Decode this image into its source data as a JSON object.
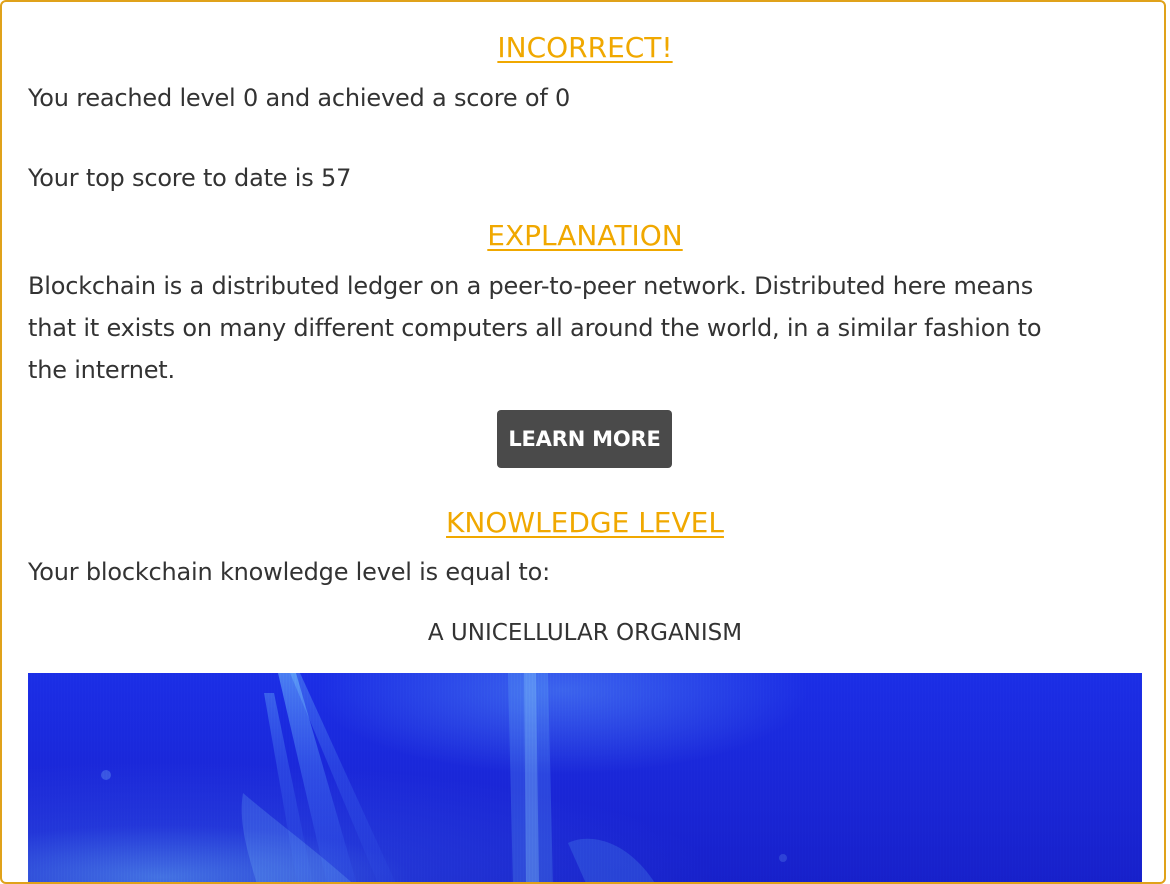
{
  "result": {
    "title": "INCORRECT!",
    "summary_line": "You reached level 0 and achieved a score of 0",
    "top_score_line": "Your top score to date is 57"
  },
  "explanation": {
    "title": "EXPLANATION",
    "text_line_1": "Blockchain is a distributed ledger on a peer-to-peer network. Distributed here means",
    "text_line_2": "that it exists on many different computers all around the world, in a similar fashion to",
    "text_line_3": "the internet.",
    "learn_more_label": "LEARN MORE"
  },
  "knowledge": {
    "title": "KNOWLEDGE LEVEL",
    "intro": "Your blockchain knowledge level is equal to:",
    "level_name": "A UNICELLULAR ORGANISM"
  },
  "colors": {
    "accent": "#f0a800",
    "frame_border": "#e0a21a",
    "button_bg": "#4a4a4a",
    "text": "#333333",
    "image_blue": "#1b2ee6"
  }
}
